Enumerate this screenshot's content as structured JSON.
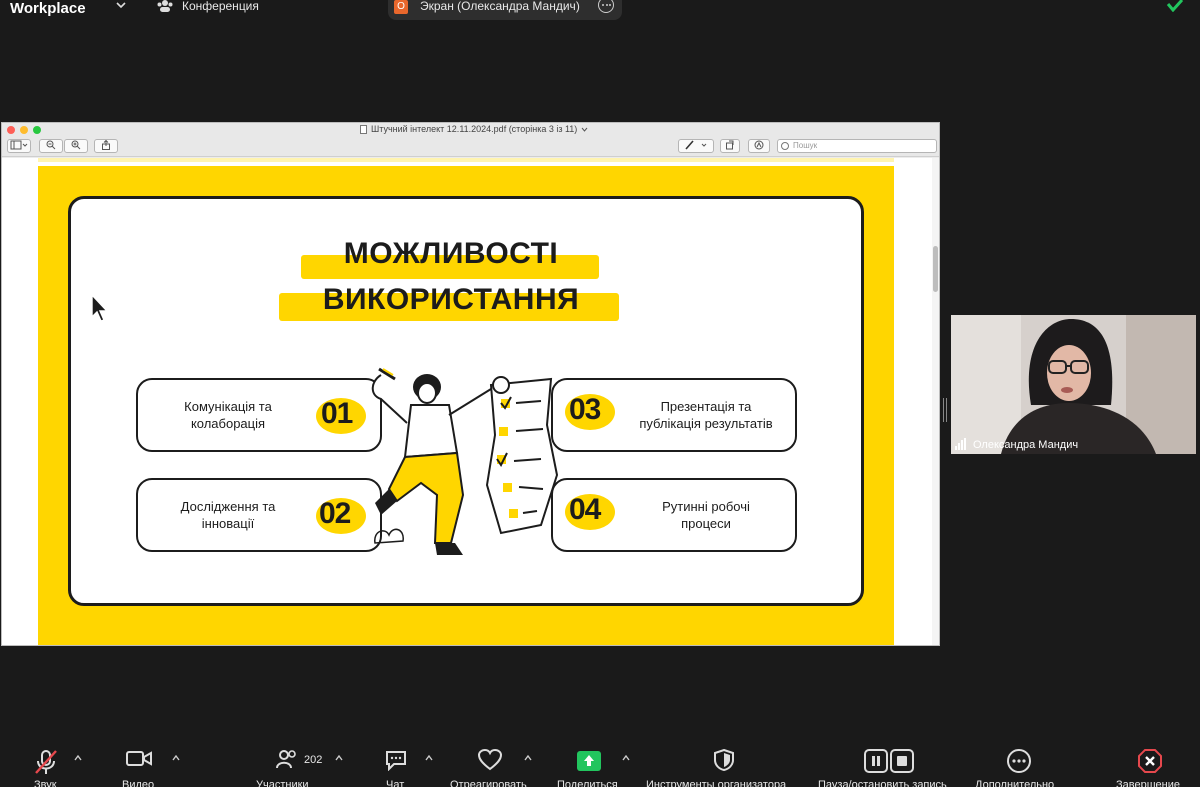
{
  "topbar": {
    "brand": "Workplace",
    "conference_label": "Конференция",
    "share_label": "Экран (Олександра Мандич)",
    "share_badge": "O"
  },
  "pdf_window": {
    "title": "Штучний інтелект 12.11.2024.pdf (сторінка 3 із 11)",
    "search_placeholder": "Пошук",
    "slide": {
      "title_line1": "МОЖЛИВОСТІ",
      "title_line2": "ВИКОРИСТАННЯ",
      "items": [
        {
          "num": "01",
          "text_line1": "Комунікація та",
          "text_line2": "колаборація"
        },
        {
          "num": "02",
          "text_line1": "Дослідження та",
          "text_line2": "інновації"
        },
        {
          "num": "03",
          "text_line1": "Презентація та",
          "text_line2": "публікація результатів"
        },
        {
          "num": "04",
          "text_line1": "Рутинні робочі",
          "text_line2": "процеси"
        }
      ]
    }
  },
  "speaker": {
    "name": "Олександра Мандич"
  },
  "bottombar": {
    "audio_label": "Звук",
    "video_label": "Видео",
    "participants_label": "Участники",
    "participants_count": "202",
    "chat_label": "Чат",
    "react_label": "Отреагировать",
    "share_label": "Поделиться",
    "host_tools_label": "Инструменты организатора",
    "record_label": "Пауза/остановить запись",
    "more_label": "Дополнительно",
    "end_label": "Завершение"
  },
  "colors": {
    "slide_yellow": "#ffd600",
    "share_green": "#22c55e",
    "end_red": "#e5484d",
    "share_badge_orange": "#e8672c"
  }
}
